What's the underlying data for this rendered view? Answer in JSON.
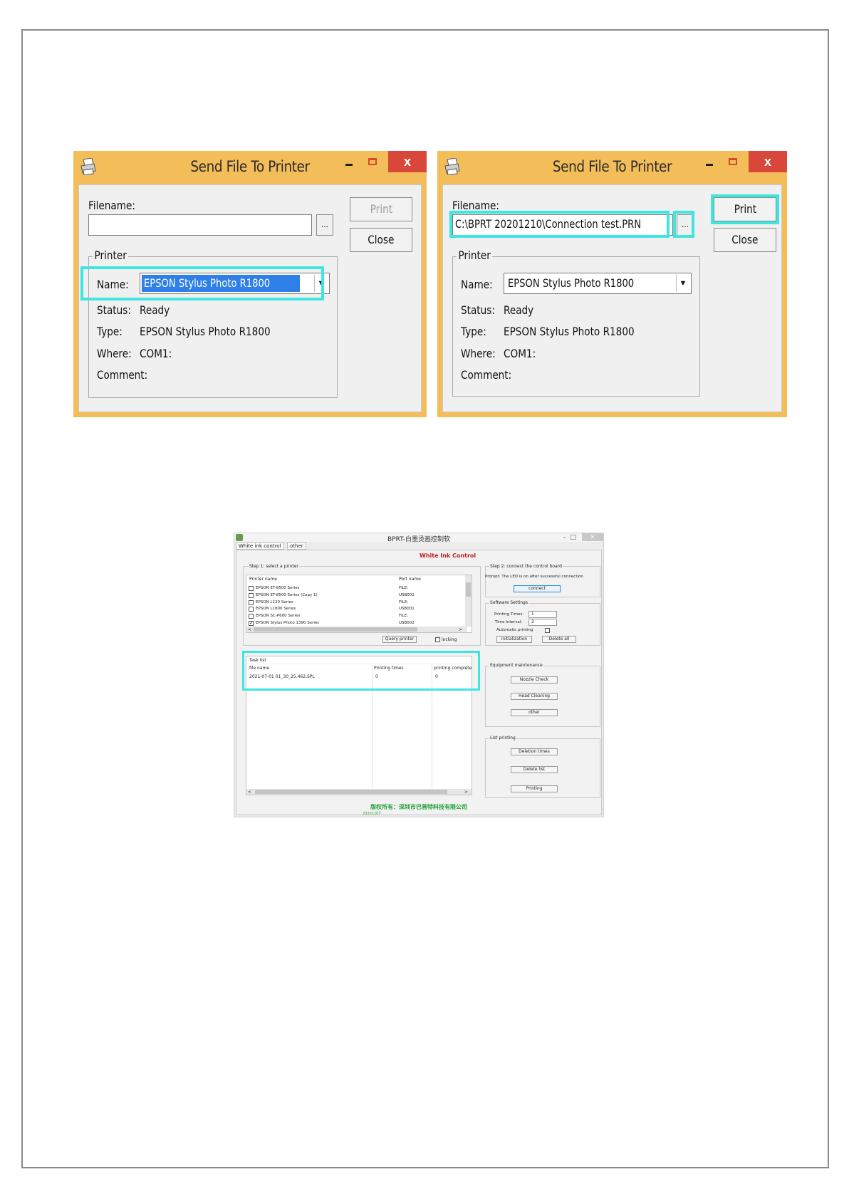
{
  "dialogs": [
    {
      "title": "Send File To Printer",
      "close_glyph": "x",
      "filename_label": "Filename:",
      "filename_value": "",
      "browse_label": "...",
      "print_label": "Print",
      "close_label": "Close",
      "group_label": "Printer",
      "name_label": "Name:",
      "name_value": "EPSON Stylus Photo R1800",
      "status_label": "Status:",
      "status_value": "Ready",
      "type_label": "Type:",
      "type_value": "EPSON Stylus Photo R1800",
      "where_label": "Where:",
      "where_value": "COM1:",
      "comment_label": "Comment:",
      "comment_value": ""
    },
    {
      "title": "Send File To Printer",
      "close_glyph": "x",
      "filename_label": "Filename:",
      "filename_value": "C:\\BPRT  20201210\\Connection test.PRN",
      "browse_label": "...",
      "print_label": "Print",
      "close_label": "Close",
      "group_label": "Printer",
      "name_label": "Name:",
      "name_value": "EPSON Stylus Photo R1800",
      "status_label": "Status:",
      "status_value": "Ready",
      "type_label": "Type:",
      "type_value": "EPSON Stylus Photo R1800",
      "where_label": "Where:",
      "where_value": "COM1:",
      "comment_label": "Comment:",
      "comment_value": ""
    }
  ],
  "app": {
    "title": "BPRT-白墨烫画控制软",
    "tabs": [
      "White ink control",
      "other"
    ],
    "heading": "White Ink Control",
    "step1": {
      "title": "Step 1: select a printer",
      "columns": [
        "Printer name",
        "Port name"
      ],
      "printers": [
        {
          "name": "EPSON ET-8500 Series",
          "port": "FILE:",
          "checked": false
        },
        {
          "name": "EPSON ET-8500 Series (Copy 1)",
          "port": "USB001",
          "checked": false
        },
        {
          "name": "EPSON L120 Series",
          "port": "FILE:",
          "checked": false
        },
        {
          "name": "EPSON L1800 Series",
          "port": "USB001",
          "checked": false
        },
        {
          "name": "EPSON SC-P600 Series",
          "port": "FILE:",
          "checked": false
        },
        {
          "name": "EPSON Stylus Photo 1390 Series",
          "port": "USB002",
          "checked": true
        }
      ],
      "query_button": "Query printer",
      "locking_label": "locking"
    },
    "task_list": {
      "title": "Task list",
      "columns": [
        "file name",
        "Printing times",
        "printing complete"
      ],
      "rows": [
        {
          "file": "2021-07-01 01_30_25.462.SPL",
          "times": "0",
          "complete": "0"
        }
      ]
    },
    "step2": {
      "title": "Step 2: connect the control board",
      "prompt": "Prompt: The LED is on after successful connection",
      "connect_button": "connect"
    },
    "software_settings": {
      "title": "Software Settings",
      "printing_times_label": "Printing Times:",
      "printing_times_value": "1",
      "time_interval_label": "Time Interval:",
      "time_interval_value": "2",
      "auto_label": "Automatic printing",
      "init_button": "initialization",
      "delete_all_button": "Delete all"
    },
    "maintenance": {
      "title": "Equipment maintenance",
      "nozzle_button": "Nozzle Check",
      "head_button": "Head Cleaning",
      "other_button": "other"
    },
    "list_printing": {
      "title": "List printing",
      "deletion_button": "Deletion times",
      "delete_list_button": "Delete list",
      "printing_button": "Printing"
    },
    "copyright": "版权所有：深圳市巴普特科技有限公司",
    "version": "20201207"
  },
  "colors": {
    "titlebar": "#f3be5a",
    "highlight": "#3ee6e0",
    "selection": "#2f7fe8",
    "close_button": "#d9463a",
    "heading_red": "#c21b1b",
    "copyright_green": "#21a03a"
  }
}
